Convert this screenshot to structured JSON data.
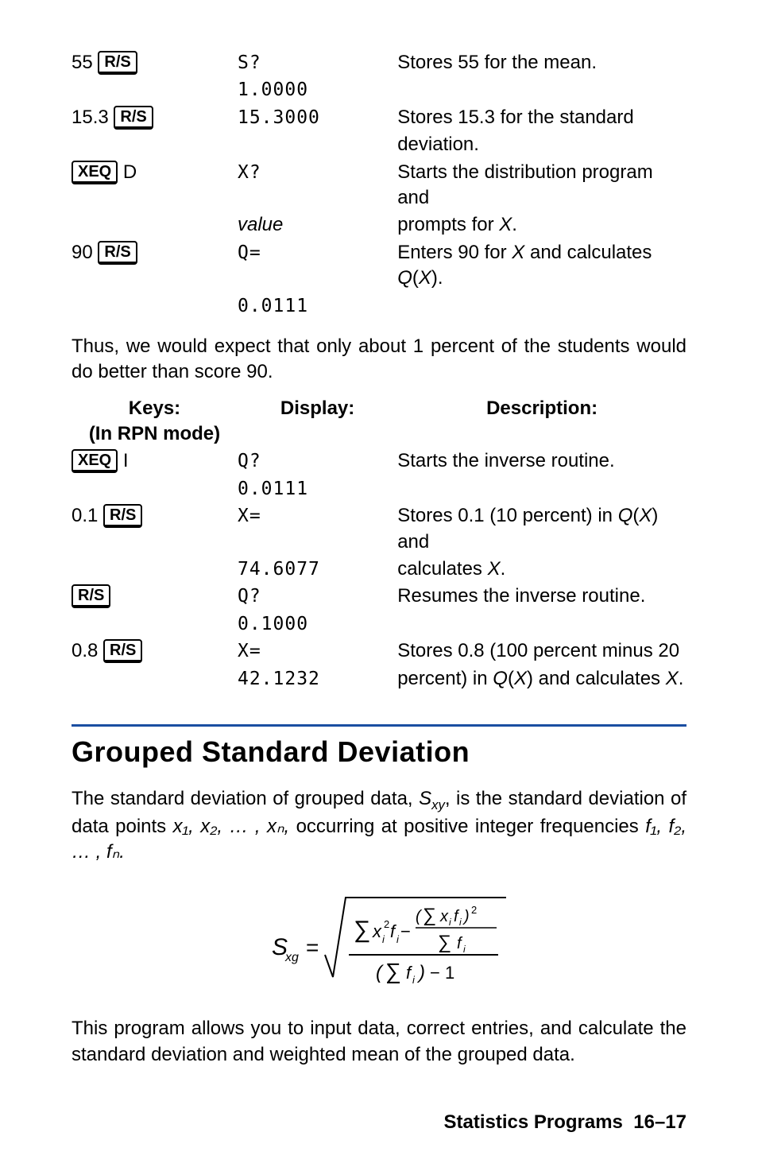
{
  "table1": {
    "rows": [
      {
        "key_pre": "55 ",
        "key_box": "R/S",
        "key_post": "",
        "disp1": "S?",
        "disp2": "1.0000",
        "desc1": "Stores 55 for the mean.",
        "desc2": ""
      },
      {
        "key_pre": "15.3 ",
        "key_box": "R/S",
        "key_post": "",
        "disp1": "15.3000",
        "disp2": "",
        "desc1": "Stores 15.3 for the standard",
        "desc2": "deviation."
      },
      {
        "key_pre": "",
        "key_box": "XEQ",
        "key_post": " D",
        "disp1": "X?",
        "disp2": "value",
        "disp2_italic": true,
        "desc1": "Starts the distribution program and",
        "desc2": "prompts for X.",
        "desc2_xitalic": true
      },
      {
        "key_pre": "90 ",
        "key_box": "R/S",
        "key_post": "",
        "disp1": "Q=",
        "disp2": "0.0111",
        "desc1": "Enters 90 for X and calculates Q(X).",
        "desc1_markup": true,
        "desc2": ""
      }
    ]
  },
  "para1": "Thus, we would expect that only about 1 percent of the students would do better than score 90.",
  "table2": {
    "head": {
      "c1a": "Keys:",
      "c1b": "(In RPN mode)",
      "c2": "Display:",
      "c3": "Description:"
    },
    "rows": [
      {
        "key_pre": "",
        "key_box": "XEQ",
        "key_post": " I",
        "disp1": "Q?",
        "disp2": "0.0111",
        "desc1": "Starts the inverse routine.",
        "desc2": ""
      },
      {
        "key_pre": "0.1 ",
        "key_box": "R/S",
        "key_post": "",
        "disp1": "X=",
        "disp2": "74.6077",
        "desc1": "Stores 0.1 (10 percent) in Q(X) and",
        "desc1_markup": true,
        "desc2": "calculates X.",
        "desc2_xitalic_plain": true
      },
      {
        "key_pre": "",
        "key_box": "R/S",
        "key_post": "",
        "disp1": "Q?",
        "disp2": "0.1000",
        "desc1": "Resumes the inverse routine.",
        "desc2": ""
      },
      {
        "key_pre": "0.8 ",
        "key_box": "R/S",
        "key_post": "",
        "disp1": "X=",
        "disp2": "42.1232",
        "desc1": "Stores 0.8 (100 percent minus 20",
        "desc2": "percent) in Q(X) and calculates X.",
        "desc2_markup": true
      }
    ]
  },
  "section": {
    "title": "Grouped Standard Deviation",
    "p1_a": "The standard deviation of grouped data, ",
    "p1_sxy": "S",
    "p1_sxy_sub": "xy",
    "p1_b": ", is the standard deviation of data points ",
    "p1_pts": "x₁, x₂, … , xₙ,",
    "p1_c": " occurring at positive integer frequencies ",
    "p1_freq": "f₁, f₂, … , fₙ.",
    "p2": "This program allows you to input data, correct entries, and calculate the standard deviation and weighted mean of the grouped data."
  },
  "formula_svg": {
    "Sxg": "S",
    "xg": "xg"
  },
  "footer": {
    "label": "Statistics Programs",
    "page": "16–17"
  }
}
